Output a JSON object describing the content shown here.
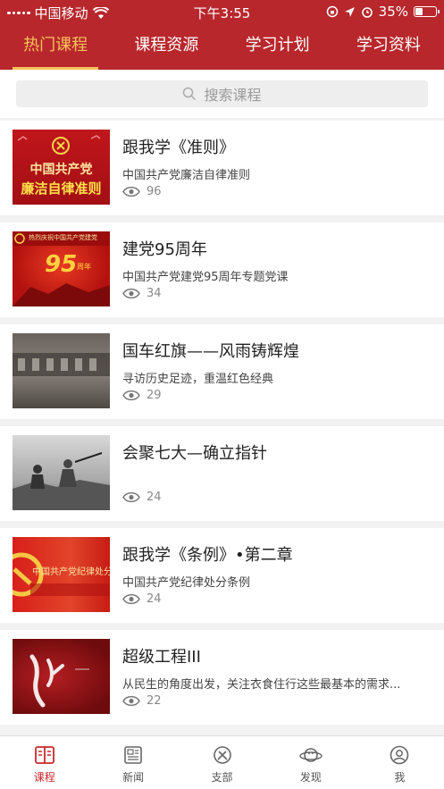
{
  "status_bar": {
    "carrier": "中国移动",
    "time": "下午3:55",
    "battery": "35%"
  },
  "tabs": [
    {
      "label": "热门课程",
      "active": true
    },
    {
      "label": "课程资源",
      "active": false
    },
    {
      "label": "学习计划",
      "active": false
    },
    {
      "label": "学习资料",
      "active": false
    }
  ],
  "search": {
    "placeholder": "搜索课程"
  },
  "courses": [
    {
      "title": "跟我学《准则》",
      "subtitle": "中国共产党廉洁自律准则",
      "views": "96",
      "thumb_text_1": "中国共产党",
      "thumb_text_2": "廉洁自律准则"
    },
    {
      "title": "建党95周年",
      "subtitle": "中国共产党建党95周年专题党课",
      "views": "34",
      "thumb_text_1": "热烈庆祝中国共产党建党",
      "thumb_text_2": "95",
      "thumb_text_3": "周年"
    },
    {
      "title": "国车红旗——风雨铸辉煌",
      "subtitle": "寻访历史足迹，重温红色经典",
      "views": "29"
    },
    {
      "title": "会聚七大—确立指针",
      "subtitle": "",
      "views": "24"
    },
    {
      "title": "跟我学《条例》•第二章",
      "subtitle": "中国共产党纪律处分条例",
      "views": "24",
      "thumb_text_1": "中国共产党纪律处分条"
    },
    {
      "title": "超级工程III",
      "subtitle": "从民生的角度出发，关注衣食住行这些最基本的需求...",
      "views": "22"
    }
  ],
  "bottom_nav": [
    {
      "label": "课程",
      "icon": "book-icon",
      "active": true
    },
    {
      "label": "新闻",
      "icon": "newspaper-icon",
      "active": false
    },
    {
      "label": "支部",
      "icon": "party-emblem-icon",
      "active": false
    },
    {
      "label": "发现",
      "icon": "planet-icon",
      "active": false
    },
    {
      "label": "我",
      "icon": "user-icon",
      "active": false
    }
  ],
  "colors": {
    "primary": "#b8272c",
    "accent": "#f6c35a"
  }
}
